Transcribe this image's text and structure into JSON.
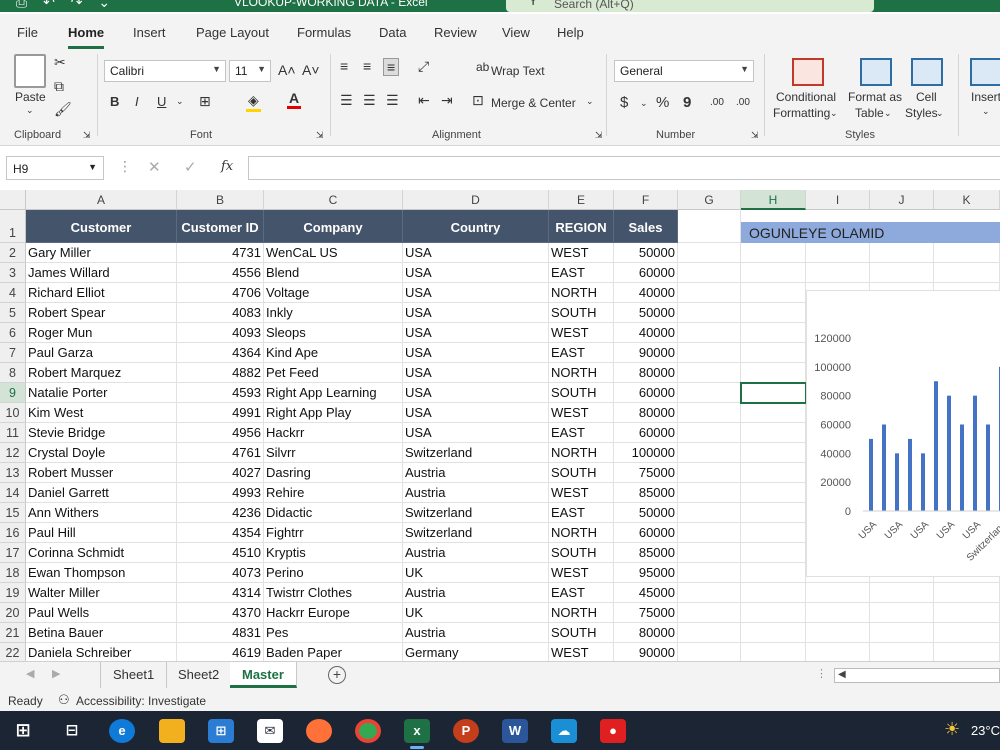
{
  "window": {
    "title": "VLOOKUP-WORKING DATA  -  Excel",
    "search_placeholder": "Search (Alt+Q)"
  },
  "menu_tabs": [
    "File",
    "Home",
    "Insert",
    "Page Layout",
    "Formulas",
    "Data",
    "Review",
    "View",
    "Help"
  ],
  "active_tab": "Home",
  "ribbon": {
    "clipboard": {
      "paste": "Paste",
      "label": "Clipboard"
    },
    "font": {
      "name": "Calibri",
      "size": "11",
      "bold": "B",
      "italic": "I",
      "underline": "U",
      "grow": "A˄",
      "shrink": "A˅",
      "label": "Font"
    },
    "alignment": {
      "wrap_text": "Wrap Text",
      "merge_center": "Merge & Center",
      "label": "Alignment"
    },
    "number": {
      "format": "General",
      "currency": "$",
      "percent": "%",
      "comma": "9",
      "inc_decimal": ".00",
      "dec_decimal": ".00",
      "label": "Number"
    },
    "styles": {
      "conditional": "Conditional",
      "formatting": "Formatting",
      "format_as": "Format as",
      "table": "Table",
      "cell": "Cell",
      "cell_styles": "Styles",
      "label": "Styles"
    },
    "cells": {
      "insert": "Insert"
    }
  },
  "formula_bar": {
    "name_box": "H9",
    "fx": "fx",
    "formula": ""
  },
  "columns": [
    "A",
    "B",
    "C",
    "D",
    "E",
    "F",
    "G",
    "H",
    "I",
    "J",
    "K"
  ],
  "selected_column": "H",
  "selected_row": "9",
  "header_row": [
    "Customer",
    "Customer ID",
    "Company",
    "Country",
    "REGION",
    "Sales"
  ],
  "rows": [
    [
      "Gary Miller",
      "4731",
      "WenCaL US",
      "USA",
      "WEST",
      "50000"
    ],
    [
      "James Willard",
      "4556",
      "Blend",
      "USA",
      "EAST",
      "60000"
    ],
    [
      "Richard Elliot",
      "4706",
      "Voltage",
      "USA",
      "NORTH",
      "40000"
    ],
    [
      "Robert Spear",
      "4083",
      "Inkly",
      "USA",
      "SOUTH",
      "50000"
    ],
    [
      "Roger Mun",
      "4093",
      "Sleops",
      "USA",
      "WEST",
      "40000"
    ],
    [
      "Paul Garza",
      "4364",
      "Kind Ape",
      "USA",
      "EAST",
      "90000"
    ],
    [
      "Robert Marquez",
      "4882",
      "Pet Feed",
      "USA",
      "NORTH",
      "80000"
    ],
    [
      "Natalie Porter",
      "4593",
      "Right App Learning",
      "USA",
      "SOUTH",
      "60000"
    ],
    [
      "Kim West",
      "4991",
      "Right App Play",
      "USA",
      "WEST",
      "80000"
    ],
    [
      "Stevie Bridge",
      "4956",
      "Hackrr",
      "USA",
      "EAST",
      "60000"
    ],
    [
      "Crystal Doyle",
      "4761",
      "Silvrr",
      "Switzerland",
      "NORTH",
      "100000"
    ],
    [
      "Robert Musser",
      "4027",
      "Dasring",
      "Austria",
      "SOUTH",
      "75000"
    ],
    [
      "Daniel Garrett",
      "4993",
      "Rehire",
      "Austria",
      "WEST",
      "85000"
    ],
    [
      "Ann Withers",
      "4236",
      "Didactic",
      "Switzerland",
      "EAST",
      "50000"
    ],
    [
      "Paul Hill",
      "4354",
      "Fightrr",
      "Switzerland",
      "NORTH",
      "60000"
    ],
    [
      "Corinna Schmidt",
      "4510",
      "Kryptis",
      "Austria",
      "SOUTH",
      "85000"
    ],
    [
      "Ewan Thompson",
      "4073",
      "Perino",
      "UK",
      "WEST",
      "95000"
    ],
    [
      "Walter Miller",
      "4314",
      "Twistrr Clothes",
      "Austria",
      "EAST",
      "45000"
    ],
    [
      "Paul Wells",
      "4370",
      "Hackrr Europe",
      "UK",
      "NORTH",
      "75000"
    ],
    [
      "Betina Bauer",
      "4831",
      "Pes",
      "Austria",
      "SOUTH",
      "80000"
    ],
    [
      "Daniela Schreiber",
      "4619",
      "Baden Paper",
      "Germany",
      "WEST",
      "90000"
    ]
  ],
  "banner_text": "OGUNLEYE OLAMID",
  "chart_data": {
    "type": "bar",
    "categories": [
      "USA",
      "USA",
      "USA",
      "USA",
      "USA",
      "USA",
      "USA",
      "USA",
      "USA",
      "USA",
      "Switzerland"
    ],
    "visible_category_labels": [
      "USA",
      "USA",
      "USA",
      "USA",
      "USA",
      "Switzerland"
    ],
    "values": [
      50000,
      60000,
      40000,
      50000,
      40000,
      90000,
      80000,
      60000,
      80000,
      60000,
      100000
    ],
    "ylim": [
      0,
      120000
    ],
    "yticks": [
      "120000",
      "100000",
      "80000",
      "60000",
      "40000",
      "20000",
      "0"
    ],
    "bar_color": "#4472c4",
    "grid": false
  },
  "sheet_tabs": [
    "Sheet1",
    "Sheet2",
    "Master"
  ],
  "active_sheet": "Master",
  "status": {
    "ready": "Ready",
    "accessibility": "Accessibility: Investigate"
  },
  "taskbar": {
    "temperature": "23°C",
    "apps": [
      "windows-start",
      "task-view",
      "edge",
      "file-explorer",
      "store",
      "mail",
      "firefox",
      "chrome",
      "excel",
      "powerpoint",
      "word",
      "cloud-upload",
      "screen-recorder"
    ]
  },
  "colors": {
    "excel_green": "#1e7145",
    "header_fill": "#44546a",
    "banner_fill": "#8ea9db"
  }
}
